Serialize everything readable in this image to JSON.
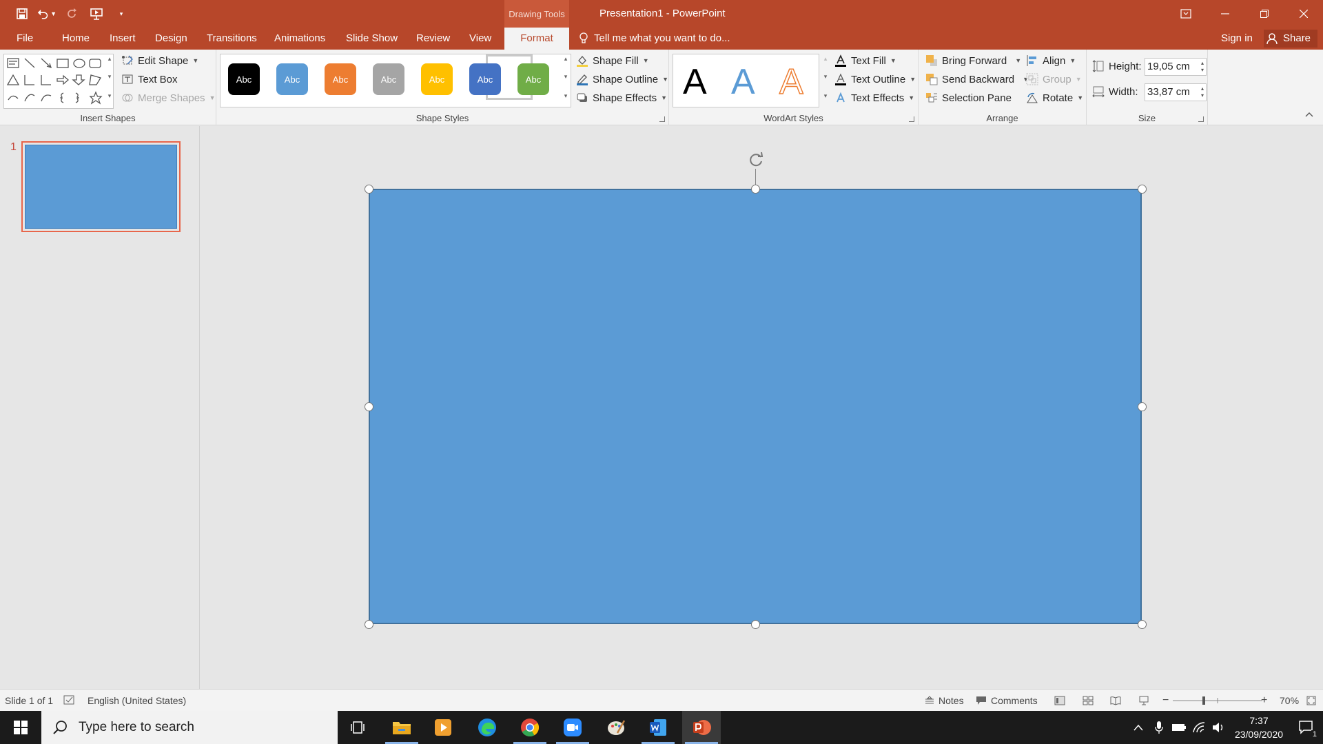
{
  "window": {
    "title": "Presentation1 - PowerPoint",
    "context_group": "Drawing Tools"
  },
  "tabs": [
    "File",
    "Home",
    "Insert",
    "Design",
    "Transitions",
    "Animations",
    "Slide Show",
    "Review",
    "View",
    "Format"
  ],
  "active_tab": "Format",
  "tell_me": "Tell me what you want to do...",
  "account": {
    "sign_in": "Sign in",
    "share": "Share"
  },
  "ribbon": {
    "insert_shapes": {
      "label": "Insert Shapes",
      "edit_shape": "Edit Shape",
      "text_box": "Text Box",
      "merge_shapes": "Merge Shapes"
    },
    "shape_styles": {
      "label": "Shape Styles",
      "swatches": [
        {
          "text": "Abc",
          "color": "#000000"
        },
        {
          "text": "Abc",
          "color": "#5b9bd5"
        },
        {
          "text": "Abc",
          "color": "#ed7d31"
        },
        {
          "text": "Abc",
          "color": "#a5a5a5"
        },
        {
          "text": "Abc",
          "color": "#ffc000"
        },
        {
          "text": "Abc",
          "color": "#4472c4"
        },
        {
          "text": "Abc",
          "color": "#70ad47"
        }
      ],
      "shape_fill": "Shape Fill",
      "shape_outline": "Shape Outline",
      "shape_effects": "Shape Effects"
    },
    "wordart_styles": {
      "label": "WordArt Styles",
      "letters": [
        "A",
        "A",
        "A"
      ],
      "text_fill": "Text Fill",
      "text_outline": "Text Outline",
      "text_effects": "Text Effects"
    },
    "arrange": {
      "label": "Arrange",
      "bring_forward": "Bring Forward",
      "send_backward": "Send Backward",
      "selection_pane": "Selection Pane",
      "align": "Align",
      "group": "Group",
      "rotate": "Rotate"
    },
    "size": {
      "label": "Size",
      "height_label": "Height:",
      "height_value": "19,05 cm",
      "width_label": "Width:",
      "width_value": "33,87 cm"
    }
  },
  "thumbnails": [
    {
      "number": "1"
    }
  ],
  "status": {
    "slide_info": "Slide 1 of 1",
    "language": "English (United States)",
    "notes": "Notes",
    "comments": "Comments",
    "zoom": "70%"
  },
  "taskbar": {
    "search_placeholder": "Type here to search",
    "time": "7:37",
    "date": "23/09/2020",
    "notification_count": "1"
  },
  "colors": {
    "accent": "#b7472a",
    "shape_fill": "#5b9bd5"
  }
}
